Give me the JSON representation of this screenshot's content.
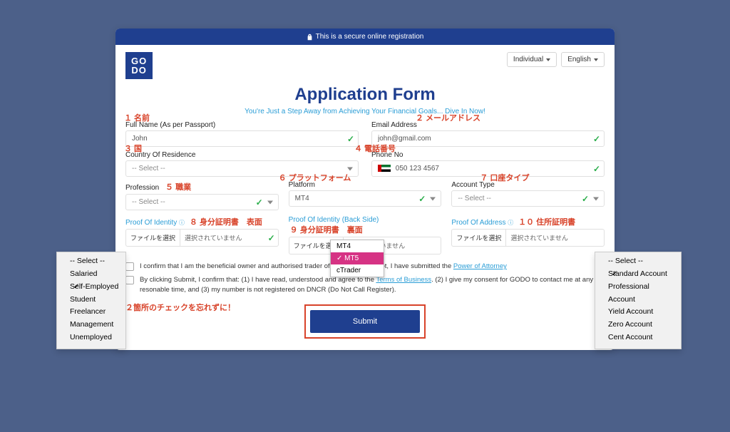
{
  "secure_text": "This is a secure online registration",
  "logo_line1": "GO",
  "logo_line2": "DO",
  "header": {
    "individual": "Individual",
    "english": "English"
  },
  "title": "Application Form",
  "subtitle": "You're Just a Step Away from Achieving Your Financial Goals... Dive In Now!",
  "labels": {
    "full_name": "Full Name (As per Passport)",
    "email": "Email Address",
    "country": "Country Of Residence",
    "phone": "Phone No",
    "profession": "Profession",
    "platform": "Platform",
    "account_type": "Account Type",
    "proof_id": "Proof Of Identity",
    "proof_id_back": "Proof Of Identity (Back Side)",
    "proof_address": "Proof Of Address"
  },
  "values": {
    "full_name": "John",
    "email": "john@gmail.com",
    "country": "-- Select --",
    "phone": "050 123 4567",
    "profession": "-- Select --",
    "platform": "MT4",
    "account_type": "-- Select --",
    "file_btn": "ファイルを選択",
    "file_none": "選択されていません"
  },
  "checkbox1_pre": "I confirm that I am the beneficial owner and authorised trader of this account. If not, I have submitted the ",
  "checkbox1_link": "Power of Attorney",
  "checkbox2_pre": "By clicking Submit, I confirm that: (1) I have read, understood and agree to the ",
  "checkbox2_link": "Terms of Business",
  "checkbox2_post": ". (2) I give my consent for GODO to contact me at any resonable time, and (3) my number is not registered on DNCR (Do Not Call Register).",
  "submit": "Submit",
  "annotations": {
    "a1": "１ 名前",
    "a2": "２ メールアドレス",
    "a3": "３ 国",
    "a4": "４ 電話番号",
    "a5": "５ 職業",
    "a6": "６ プラットフォーム",
    "a7": "７ 口座タイプ",
    "a8": "８ 身分証明書　表面",
    "a9": "９ 身分証明書　裏面",
    "a10": "１０ 住所証明書",
    "a_check": "２箇所のチェックを忘れずに！"
  },
  "profession_menu": [
    "-- Select --",
    "Salaried",
    "Self-Employed",
    "Student",
    "Freelancer",
    "Management",
    "Unemployed"
  ],
  "profession_selected": "Self-Employed",
  "account_menu": [
    "-- Select --",
    "Standard Account",
    "Professional Account",
    "Yield Account",
    "Zero Account",
    "Cent Account"
  ],
  "account_selected": "Standard Account",
  "platform_menu": [
    "MT4",
    "MT5",
    "cTrader"
  ],
  "platform_selected": "MT5"
}
